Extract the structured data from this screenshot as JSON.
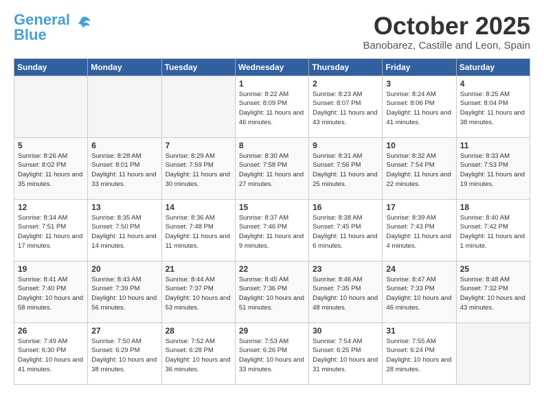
{
  "header": {
    "logo_general": "General",
    "logo_blue": "Blue",
    "month_title": "October 2025",
    "location": "Banobarez, Castille and Leon, Spain"
  },
  "weekdays": [
    "Sunday",
    "Monday",
    "Tuesday",
    "Wednesday",
    "Thursday",
    "Friday",
    "Saturday"
  ],
  "weeks": [
    [
      {
        "day": "",
        "sunrise": "",
        "sunset": "",
        "daylight": ""
      },
      {
        "day": "",
        "sunrise": "",
        "sunset": "",
        "daylight": ""
      },
      {
        "day": "",
        "sunrise": "",
        "sunset": "",
        "daylight": ""
      },
      {
        "day": "1",
        "sunrise": "Sunrise: 8:22 AM",
        "sunset": "Sunset: 8:09 PM",
        "daylight": "Daylight: 11 hours and 46 minutes."
      },
      {
        "day": "2",
        "sunrise": "Sunrise: 8:23 AM",
        "sunset": "Sunset: 8:07 PM",
        "daylight": "Daylight: 11 hours and 43 minutes."
      },
      {
        "day": "3",
        "sunrise": "Sunrise: 8:24 AM",
        "sunset": "Sunset: 8:06 PM",
        "daylight": "Daylight: 11 hours and 41 minutes."
      },
      {
        "day": "4",
        "sunrise": "Sunrise: 8:25 AM",
        "sunset": "Sunset: 8:04 PM",
        "daylight": "Daylight: 11 hours and 38 minutes."
      }
    ],
    [
      {
        "day": "5",
        "sunrise": "Sunrise: 8:26 AM",
        "sunset": "Sunset: 8:02 PM",
        "daylight": "Daylight: 11 hours and 35 minutes."
      },
      {
        "day": "6",
        "sunrise": "Sunrise: 8:28 AM",
        "sunset": "Sunset: 8:01 PM",
        "daylight": "Daylight: 11 hours and 33 minutes."
      },
      {
        "day": "7",
        "sunrise": "Sunrise: 8:29 AM",
        "sunset": "Sunset: 7:59 PM",
        "daylight": "Daylight: 11 hours and 30 minutes."
      },
      {
        "day": "8",
        "sunrise": "Sunrise: 8:30 AM",
        "sunset": "Sunset: 7:58 PM",
        "daylight": "Daylight: 11 hours and 27 minutes."
      },
      {
        "day": "9",
        "sunrise": "Sunrise: 8:31 AM",
        "sunset": "Sunset: 7:56 PM",
        "daylight": "Daylight: 11 hours and 25 minutes."
      },
      {
        "day": "10",
        "sunrise": "Sunrise: 8:32 AM",
        "sunset": "Sunset: 7:54 PM",
        "daylight": "Daylight: 11 hours and 22 minutes."
      },
      {
        "day": "11",
        "sunrise": "Sunrise: 8:33 AM",
        "sunset": "Sunset: 7:53 PM",
        "daylight": "Daylight: 11 hours and 19 minutes."
      }
    ],
    [
      {
        "day": "12",
        "sunrise": "Sunrise: 8:34 AM",
        "sunset": "Sunset: 7:51 PM",
        "daylight": "Daylight: 11 hours and 17 minutes."
      },
      {
        "day": "13",
        "sunrise": "Sunrise: 8:35 AM",
        "sunset": "Sunset: 7:50 PM",
        "daylight": "Daylight: 11 hours and 14 minutes."
      },
      {
        "day": "14",
        "sunrise": "Sunrise: 8:36 AM",
        "sunset": "Sunset: 7:48 PM",
        "daylight": "Daylight: 11 hours and 11 minutes."
      },
      {
        "day": "15",
        "sunrise": "Sunrise: 8:37 AM",
        "sunset": "Sunset: 7:46 PM",
        "daylight": "Daylight: 11 hours and 9 minutes."
      },
      {
        "day": "16",
        "sunrise": "Sunrise: 8:38 AM",
        "sunset": "Sunset: 7:45 PM",
        "daylight": "Daylight: 11 hours and 6 minutes."
      },
      {
        "day": "17",
        "sunrise": "Sunrise: 8:39 AM",
        "sunset": "Sunset: 7:43 PM",
        "daylight": "Daylight: 11 hours and 4 minutes."
      },
      {
        "day": "18",
        "sunrise": "Sunrise: 8:40 AM",
        "sunset": "Sunset: 7:42 PM",
        "daylight": "Daylight: 11 hours and 1 minute."
      }
    ],
    [
      {
        "day": "19",
        "sunrise": "Sunrise: 8:41 AM",
        "sunset": "Sunset: 7:40 PM",
        "daylight": "Daylight: 10 hours and 58 minutes."
      },
      {
        "day": "20",
        "sunrise": "Sunrise: 8:43 AM",
        "sunset": "Sunset: 7:39 PM",
        "daylight": "Daylight: 10 hours and 56 minutes."
      },
      {
        "day": "21",
        "sunrise": "Sunrise: 8:44 AM",
        "sunset": "Sunset: 7:37 PM",
        "daylight": "Daylight: 10 hours and 53 minutes."
      },
      {
        "day": "22",
        "sunrise": "Sunrise: 8:45 AM",
        "sunset": "Sunset: 7:36 PM",
        "daylight": "Daylight: 10 hours and 51 minutes."
      },
      {
        "day": "23",
        "sunrise": "Sunrise: 8:46 AM",
        "sunset": "Sunset: 7:35 PM",
        "daylight": "Daylight: 10 hours and 48 minutes."
      },
      {
        "day": "24",
        "sunrise": "Sunrise: 8:47 AM",
        "sunset": "Sunset: 7:33 PM",
        "daylight": "Daylight: 10 hours and 46 minutes."
      },
      {
        "day": "25",
        "sunrise": "Sunrise: 8:48 AM",
        "sunset": "Sunset: 7:32 PM",
        "daylight": "Daylight: 10 hours and 43 minutes."
      }
    ],
    [
      {
        "day": "26",
        "sunrise": "Sunrise: 7:49 AM",
        "sunset": "Sunset: 6:30 PM",
        "daylight": "Daylight: 10 hours and 41 minutes."
      },
      {
        "day": "27",
        "sunrise": "Sunrise: 7:50 AM",
        "sunset": "Sunset: 6:29 PM",
        "daylight": "Daylight: 10 hours and 38 minutes."
      },
      {
        "day": "28",
        "sunrise": "Sunrise: 7:52 AM",
        "sunset": "Sunset: 6:28 PM",
        "daylight": "Daylight: 10 hours and 36 minutes."
      },
      {
        "day": "29",
        "sunrise": "Sunrise: 7:53 AM",
        "sunset": "Sunset: 6:26 PM",
        "daylight": "Daylight: 10 hours and 33 minutes."
      },
      {
        "day": "30",
        "sunrise": "Sunrise: 7:54 AM",
        "sunset": "Sunset: 6:25 PM",
        "daylight": "Daylight: 10 hours and 31 minutes."
      },
      {
        "day": "31",
        "sunrise": "Sunrise: 7:55 AM",
        "sunset": "Sunset: 6:24 PM",
        "daylight": "Daylight: 10 hours and 28 minutes."
      },
      {
        "day": "",
        "sunrise": "",
        "sunset": "",
        "daylight": ""
      }
    ]
  ]
}
